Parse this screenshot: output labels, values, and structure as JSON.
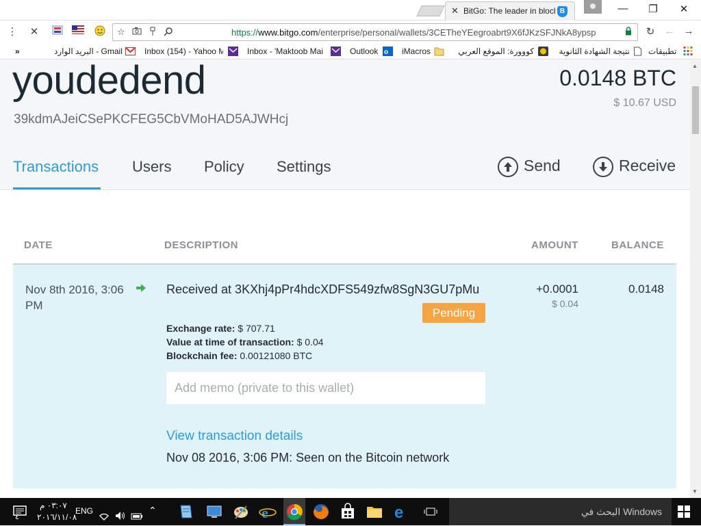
{
  "browser": {
    "tab_title": "BitGo: The leader in blockchain",
    "tab_favicon": "B",
    "url_scheme": "https://",
    "url_domain": "www.bitgo.com",
    "url_path": "/enterprise/personal/wallets/3CETheYEegroabrt9X6fJKzSFJNkA8ypsp",
    "window": {
      "minimize": "—",
      "maximize": "❐",
      "close": "✕"
    }
  },
  "bookmarks": [
    "تطبيقات",
    "نتيجة الشهادة الثانوية",
    "كووورة: الموقع العربي",
    "iMacros",
    "Outlook",
    "Inbox - 'Maktoob Mai",
    "Inbox (154) - Yahoo M",
    "البريد الوارد - Gmail"
  ],
  "bookmarks_more": "»",
  "wallet": {
    "name": "youdedend",
    "address": "39kdmAJeiCSePKCFEG5CbVMoHAD5AJWHcj",
    "balance_btc": "0.0148 BTC",
    "balance_usd": "$ 10.67 USD"
  },
  "nav": {
    "tabs": [
      "Transactions",
      "Users",
      "Policy",
      "Settings"
    ],
    "active_tab": "Transactions",
    "send": "Send",
    "receive": "Receive"
  },
  "table": {
    "headers": {
      "date": "DATE",
      "description": "DESCRIPTION",
      "amount": "AMOUNT",
      "balance": "BALANCE"
    }
  },
  "transaction": {
    "date": "Nov 8th 2016, 3:06 PM",
    "description": "Received at 3KXhj4pPr4hdcXDFS549zfw8SgN3GU7pMu",
    "status": "Pending",
    "amount": "+0.0001",
    "amount_usd": "$ 0.04",
    "balance": "0.0148",
    "exchange_rate_label": "Exchange rate:",
    "exchange_rate_value": "$ 707.71",
    "value_label": "Value at time of transaction:",
    "value_value": "$ 0.04",
    "fee_label": "Blockchain fee:",
    "fee_value": "0.00121080 BTC",
    "memo_placeholder": "Add memo (private to this wallet)",
    "details_link": "View transaction details",
    "seen": "Nov 08 2016, 3:06 PM: Seen on the Bitcoin network"
  },
  "taskbar": {
    "time": "٠٣:٠٧ م",
    "date": "٢٠١٦/١١/٠٨",
    "lang": "ENG",
    "notification_count": "٤",
    "search_placeholder": "البحث في Windows"
  },
  "colors": {
    "accent": "#2e9ad8",
    "pending": "#f6a341",
    "row_bg": "#dff3f9",
    "incoming_arrow": "#3fb34f"
  }
}
